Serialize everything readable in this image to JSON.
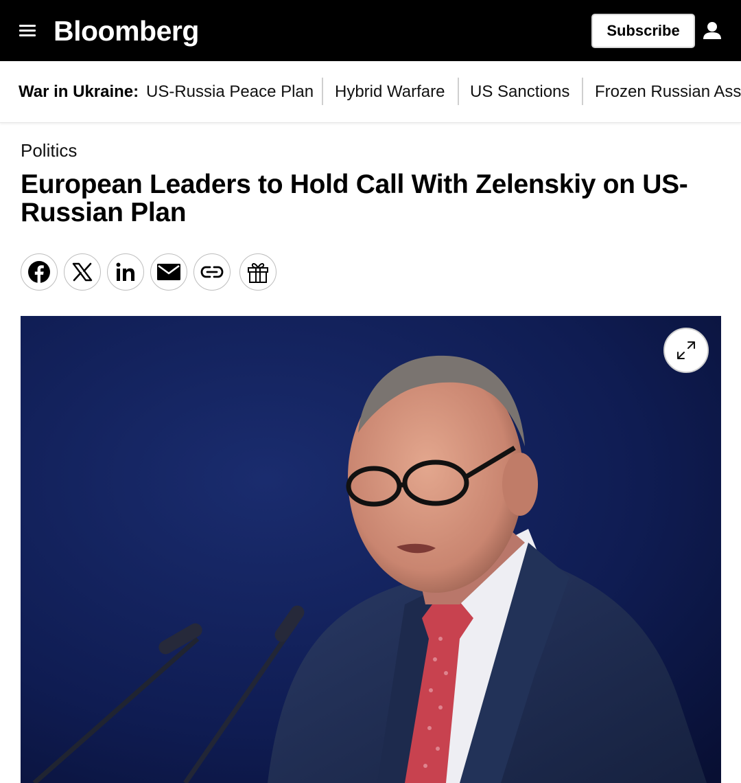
{
  "header": {
    "logo": "Bloomberg",
    "subscribe_label": "Subscribe",
    "menu_icon": "hamburger-menu-icon",
    "user_icon": "user-icon"
  },
  "topics": {
    "label": "War in Ukraine:",
    "links": [
      "US-Russia Peace Plan",
      "Hybrid Warfare",
      "US Sanctions",
      "Frozen Russian Assets"
    ]
  },
  "article": {
    "section": "Politics",
    "headline": "European Leaders to Hold Call With Zelenskiy on US-Russian Plan"
  },
  "share_icons": [
    "facebook-icon",
    "x-icon",
    "linkedin-icon",
    "email-icon",
    "link-icon",
    "gift-icon"
  ],
  "photo": {
    "expand_icon": "expand-icon"
  },
  "colors": {
    "topbar": "#000000",
    "photo_background": "#0d1846"
  }
}
